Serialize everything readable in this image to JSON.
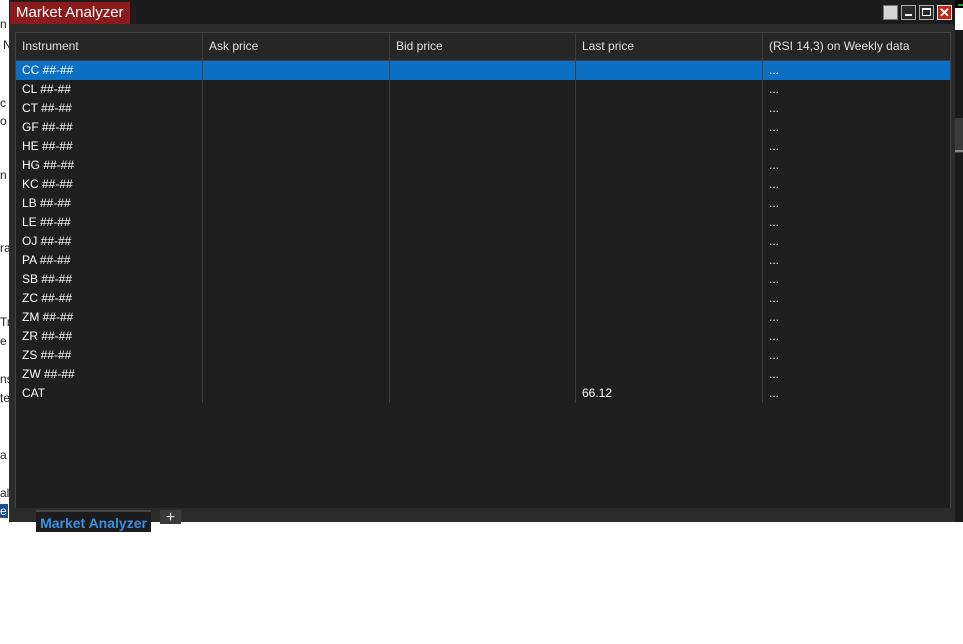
{
  "window": {
    "title": "Market Analyzer",
    "controls": {
      "restore_icon": "restore-icon",
      "minimize_icon": "minimize-icon",
      "maximize_icon": "maximize-icon",
      "close_symbol": "✕"
    }
  },
  "grid": {
    "columns": [
      "Instrument",
      "Ask price",
      "Bid price",
      "Last price",
      "(RSI 14,3) on Weekly data"
    ],
    "rows": [
      {
        "instrument": "CC ##-##",
        "ask": "",
        "bid": "",
        "last": "",
        "rsi": "..."
      },
      {
        "instrument": "CL ##-##",
        "ask": "",
        "bid": "",
        "last": "",
        "rsi": "..."
      },
      {
        "instrument": "CT ##-##",
        "ask": "",
        "bid": "",
        "last": "",
        "rsi": "..."
      },
      {
        "instrument": "GF ##-##",
        "ask": "",
        "bid": "",
        "last": "",
        "rsi": "..."
      },
      {
        "instrument": "HE ##-##",
        "ask": "",
        "bid": "",
        "last": "",
        "rsi": "..."
      },
      {
        "instrument": "HG ##-##",
        "ask": "",
        "bid": "",
        "last": "",
        "rsi": "..."
      },
      {
        "instrument": "KC ##-##",
        "ask": "",
        "bid": "",
        "last": "",
        "rsi": "..."
      },
      {
        "instrument": "LB ##-##",
        "ask": "",
        "bid": "",
        "last": "",
        "rsi": "..."
      },
      {
        "instrument": "LE ##-##",
        "ask": "",
        "bid": "",
        "last": "",
        "rsi": "..."
      },
      {
        "instrument": "OJ ##-##",
        "ask": "",
        "bid": "",
        "last": "",
        "rsi": "..."
      },
      {
        "instrument": "PA ##-##",
        "ask": "",
        "bid": "",
        "last": "",
        "rsi": "..."
      },
      {
        "instrument": "SB ##-##",
        "ask": "",
        "bid": "",
        "last": "",
        "rsi": "..."
      },
      {
        "instrument": "ZC ##-##",
        "ask": "",
        "bid": "",
        "last": "",
        "rsi": "..."
      },
      {
        "instrument": "ZM ##-##",
        "ask": "",
        "bid": "",
        "last": "",
        "rsi": "..."
      },
      {
        "instrument": "ZR ##-##",
        "ask": "",
        "bid": "",
        "last": "",
        "rsi": "..."
      },
      {
        "instrument": "ZS ##-##",
        "ask": "",
        "bid": "",
        "last": "",
        "rsi": "..."
      },
      {
        "instrument": "ZW ##-##",
        "ask": "",
        "bid": "",
        "last": "",
        "rsi": "..."
      },
      {
        "instrument": "CAT",
        "ask": "",
        "bid": "",
        "last": "66.12",
        "rsi": "..."
      }
    ],
    "selected_row": 0
  },
  "tabs": {
    "active_label": "Market Analyzer",
    "add_label": "+"
  },
  "background": {
    "left_fragments": [
      "n",
      "N",
      "c",
      "o",
      "n",
      "ra",
      "Tr",
      "e",
      "ns",
      "te",
      "a",
      "al",
      "e"
    ]
  },
  "colors": {
    "title_tab": "#8b1a1a",
    "selection": "#0b6fc4",
    "tab_text": "#3b8ee0"
  }
}
